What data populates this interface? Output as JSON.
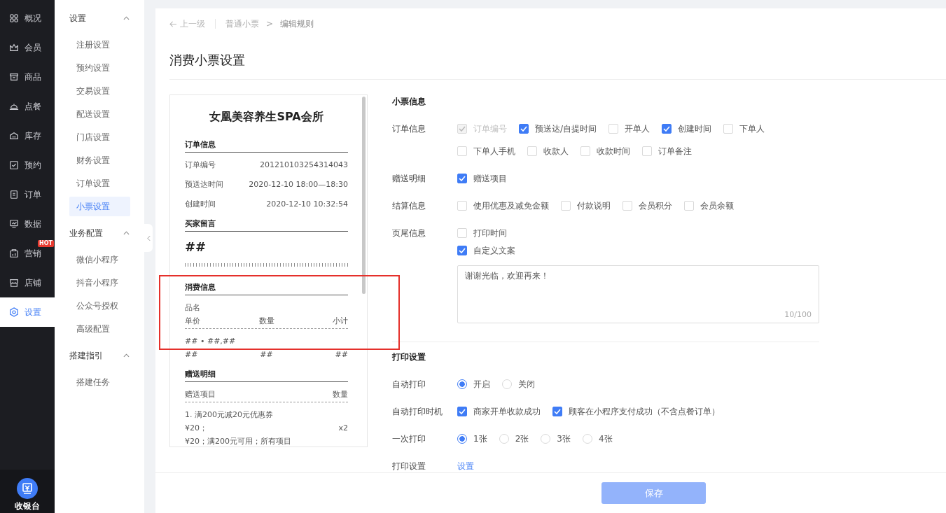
{
  "nav": {
    "items": [
      {
        "label": "概况",
        "selected": false
      },
      {
        "label": "会员",
        "selected": false
      },
      {
        "label": "商品",
        "selected": false
      },
      {
        "label": "点餐",
        "selected": false
      },
      {
        "label": "库存",
        "selected": false
      },
      {
        "label": "预约",
        "selected": false
      },
      {
        "label": "订单",
        "selected": false
      },
      {
        "label": "数据",
        "selected": false
      },
      {
        "label": "营销",
        "selected": false,
        "badge": "HOT"
      },
      {
        "label": "店铺",
        "selected": false
      },
      {
        "label": "设置",
        "selected": true
      }
    ],
    "cashier": {
      "label": "收银台"
    }
  },
  "subnav": {
    "groups": [
      {
        "title": "设置",
        "expanded": true,
        "children": [
          {
            "label": "注册设置",
            "selected": false
          },
          {
            "label": "预约设置",
            "selected": false
          },
          {
            "label": "交易设置",
            "selected": false
          },
          {
            "label": "配送设置",
            "selected": false
          },
          {
            "label": "门店设置",
            "selected": false
          },
          {
            "label": "财务设置",
            "selected": false
          },
          {
            "label": "订单设置",
            "selected": false
          },
          {
            "label": "小票设置",
            "selected": true
          }
        ]
      },
      {
        "title": "业务配置",
        "expanded": true,
        "children": [
          {
            "label": "微信小程序",
            "selected": false
          },
          {
            "label": "抖音小程序",
            "selected": false
          },
          {
            "label": "公众号授权",
            "selected": false
          },
          {
            "label": "高级配置",
            "selected": false
          }
        ]
      },
      {
        "title": "搭建指引",
        "expanded": true,
        "children": [
          {
            "label": "搭建任务",
            "selected": false
          }
        ]
      }
    ]
  },
  "breadcrumb": {
    "back": "上一级",
    "items": [
      "普通小票",
      "编辑规则"
    ],
    "separator": ">"
  },
  "page_title": "消费小票设置",
  "receipt": {
    "shop_name": "女凰美容养生SPA会所",
    "order": {
      "heading": "订单信息",
      "rows": [
        {
          "label": "订单编号",
          "value": "201210103254314043"
        },
        {
          "label": "预送达时间",
          "value": "2020-12-10 18:00—18:30"
        },
        {
          "label": "创建时间",
          "value": "2020-12-10 10:32:54"
        }
      ]
    },
    "message": {
      "heading": "买家留言",
      "value": "##"
    },
    "consumption": {
      "heading": "消费信息",
      "name_label": "品名",
      "columns": [
        "单价",
        "数量",
        "小计"
      ],
      "item_line": "## • ##,##",
      "item_values": [
        "##",
        "##",
        "##"
      ]
    },
    "gift": {
      "heading": "赠送明细",
      "columns": [
        "赠送项目",
        "数量"
      ],
      "item": "1. 满200元减20元优惠券",
      "price": "¥20；",
      "qty": "x2",
      "note": "¥20；满200元可用；所有项目"
    }
  },
  "form": {
    "sections": [
      {
        "title": "小票信息",
        "rows": [
          {
            "label": "订单信息",
            "kind": "checkbox",
            "options": [
              {
                "label": "订单编号",
                "checked": true,
                "disabled": true
              },
              {
                "label": "预送达/自提时间",
                "checked": true,
                "disabled": false
              },
              {
                "label": "开单人",
                "checked": false,
                "disabled": false
              },
              {
                "label": "创建时间",
                "checked": true,
                "disabled": false
              },
              {
                "label": "下单人",
                "checked": false,
                "disabled": false
              },
              {
                "label": "下单人手机",
                "checked": false,
                "disabled": false
              },
              {
                "label": "收款人",
                "checked": false,
                "disabled": false
              },
              {
                "label": "收款时间",
                "checked": false,
                "disabled": false
              },
              {
                "label": "订单备注",
                "checked": false,
                "disabled": false
              }
            ]
          },
          {
            "label": "赠送明细",
            "kind": "checkbox",
            "options": [
              {
                "label": "赠送项目",
                "checked": true,
                "disabled": false
              }
            ]
          },
          {
            "label": "结算信息",
            "kind": "checkbox",
            "options": [
              {
                "label": "使用优惠及减免金额",
                "checked": false,
                "disabled": false
              },
              {
                "label": "付款说明",
                "checked": false,
                "disabled": false
              },
              {
                "label": "会员积分",
                "checked": false,
                "disabled": false
              },
              {
                "label": "会员余额",
                "checked": false,
                "disabled": false
              }
            ]
          },
          {
            "label": "页尾信息",
            "kind": "checkbox-stack",
            "options": [
              {
                "label": "打印时间",
                "checked": false,
                "disabled": false
              },
              {
                "label": "自定义文案",
                "checked": true,
                "disabled": false
              }
            ],
            "textarea": {
              "value": "谢谢光临，欢迎再来！",
              "counter": "10/100"
            }
          }
        ]
      },
      {
        "title": "打印设置",
        "rows": [
          {
            "label": "自动打印",
            "kind": "radio",
            "options": [
              {
                "label": "开启",
                "selected": true
              },
              {
                "label": "关闭",
                "selected": false
              }
            ]
          },
          {
            "label": "自动打印时机",
            "kind": "checkbox",
            "options": [
              {
                "label": "商家开单收款成功",
                "checked": true,
                "disabled": false
              },
              {
                "label": "顾客在小程序支付成功（不含点餐订单）",
                "checked": true,
                "disabled": false
              }
            ]
          },
          {
            "label": "一次打印",
            "kind": "radio",
            "options": [
              {
                "label": "1张",
                "selected": true
              },
              {
                "label": "2张",
                "selected": false
              },
              {
                "label": "3张",
                "selected": false
              },
              {
                "label": "4张",
                "selected": false
              }
            ]
          },
          {
            "label": "打印设置",
            "kind": "link",
            "link": "设置"
          }
        ]
      }
    ]
  },
  "save_button": {
    "label": "保存",
    "disabled": true
  }
}
